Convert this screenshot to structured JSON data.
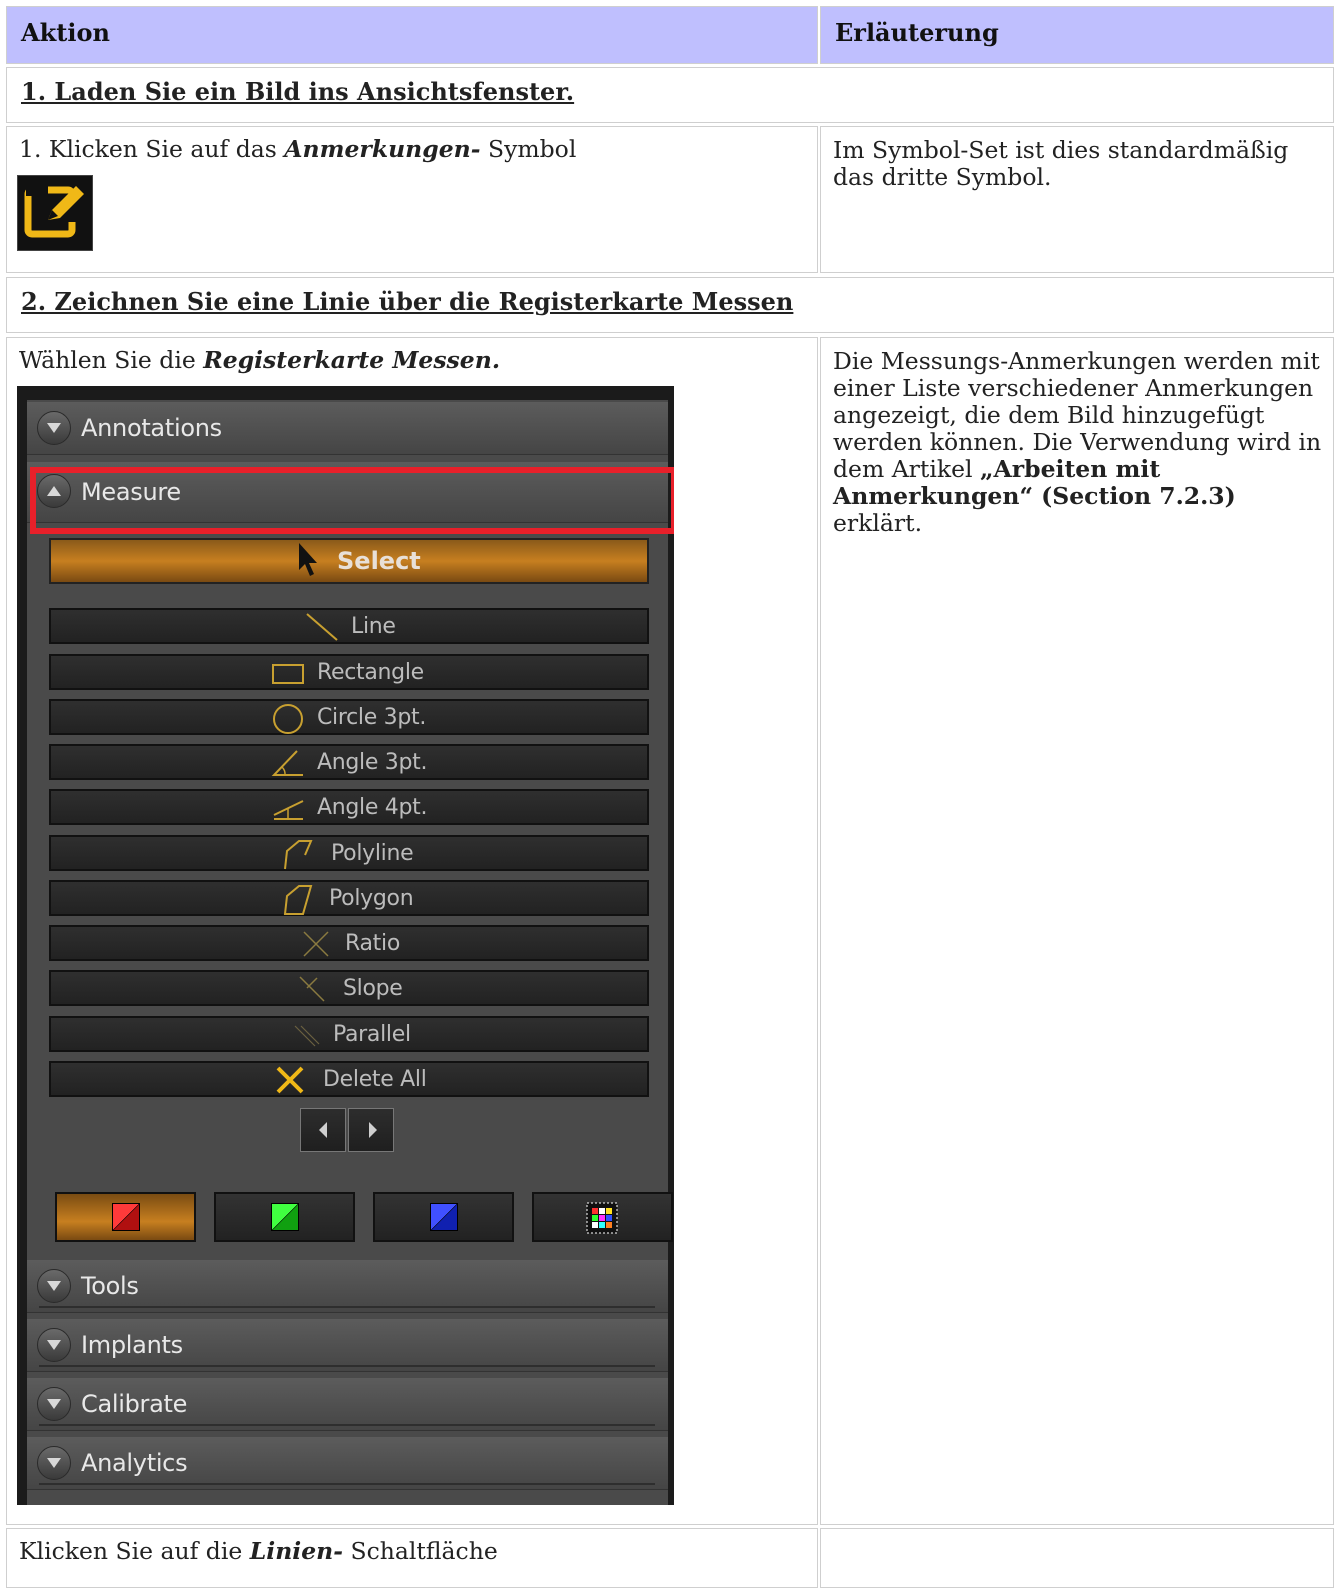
{
  "table": {
    "header_action": "Aktion",
    "header_explanation": "Erläuterung",
    "section1": "1. Laden Sie ein Bild ins Ansichtsfenster.",
    "row1_prefix": "1. Klicken Sie auf das ",
    "row1_bold": "Anmerkungen-",
    "row1_suffix": " Symbol",
    "row1_explanation": "Im Symbol-Set ist dies standardmäßig das dritte Symbol.",
    "section2": "2. Zeichnen Sie eine Linie über die Registerkarte Messen",
    "row2_prefix": "Wählen Sie die ",
    "row2_bold": "Registerkarte Messen.",
    "row2_expl_1": "Die Messungs-Anmerkungen werden mit einer Liste verschiedener Anmerkungen angezeigt, die dem Bild hinzugefügt werden können. Die Verwendung wird in dem Artikel ",
    "row2_expl_bold": "„Arbeiten mit Anmerkungen“ (Section 7.2.3)",
    "row2_expl_2": " erklärt.",
    "row3_prefix": "Klicken Sie auf die ",
    "row3_bold": "Linien-",
    "row3_suffix": " Schaltfläche"
  },
  "panel": {
    "sections_top": [
      "Annotations",
      "Measure"
    ],
    "select_label": "Select",
    "buttons": [
      "Line",
      "Rectangle",
      "Circle 3pt.",
      "Angle 3pt.",
      "Angle 4pt.",
      "Polyline",
      "Polygon",
      "Ratio",
      "Slope",
      "Parallel",
      "Delete All"
    ],
    "sections_bottom": [
      "Tools",
      "Implants",
      "Calibrate",
      "Analytics"
    ],
    "colors": [
      "#e02020",
      "#20c020",
      "#2030e0"
    ],
    "accent": "#c77f20"
  }
}
